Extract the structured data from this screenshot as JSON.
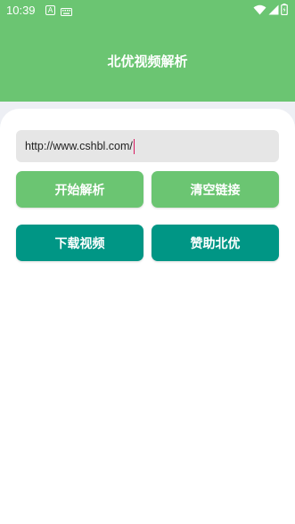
{
  "status_bar": {
    "time": "10:39",
    "notification_letter": "A"
  },
  "header": {
    "title": "北优视频解析"
  },
  "url_input": {
    "value": "http://www.cshbl.com/"
  },
  "buttons": {
    "start_parse": "开始解析",
    "clear_link": "清空链接",
    "download_video": "下载视频",
    "sponsor": "赞助北优"
  },
  "colors": {
    "primary_green": "#6bc572",
    "teal": "#009685",
    "caret": "#d81b60"
  }
}
